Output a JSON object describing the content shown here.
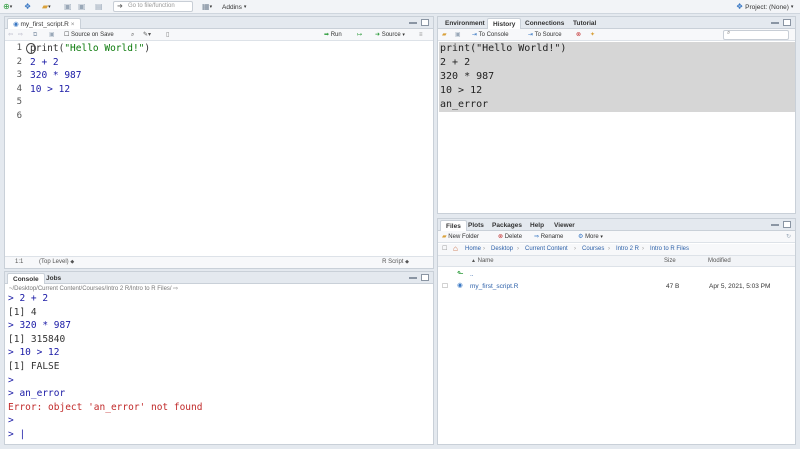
{
  "topbar": {
    "goto_placeholder": "Go to file/function",
    "addins_label": "Addins",
    "project_label": "Project: (None)"
  },
  "editor": {
    "tab_label": "my_first_script.R",
    "source_on_save": "Source on Save",
    "run_label": "Run",
    "source_label": "Source",
    "line_numbers": [
      "1",
      "2",
      "3",
      "4",
      "5",
      "6"
    ],
    "lines": [
      {
        "prefix": "print(",
        "string": "\"Hello World!\"",
        "suffix": ")"
      },
      {
        "code": "2 + 2"
      },
      {
        "code": "320 * 987"
      },
      {
        "code": "10 > 12"
      },
      {
        "code": ""
      },
      {
        "code": ""
      }
    ],
    "cursor_pos": "1:1",
    "scope": "(Top Level)",
    "filetype": "R Script"
  },
  "env_pane": {
    "tabs": [
      "Environment",
      "History",
      "Connections",
      "Tutorial"
    ],
    "active_tab": "History",
    "to_console": "To Console",
    "to_source": "To Source",
    "history": [
      "print(\"Hello World!\")",
      "2 + 2",
      "320 * 987",
      "10 > 12",
      "an_error"
    ]
  },
  "files_pane": {
    "tabs": [
      "Files",
      "Plots",
      "Packages",
      "Help",
      "Viewer"
    ],
    "new_folder": "New Folder",
    "delete": "Delete",
    "rename": "Rename",
    "more": "More",
    "breadcrumbs": [
      "Home",
      "Desktop",
      "Current Content",
      "Courses",
      "Intro 2 R",
      "Intro to R Files"
    ],
    "columns": {
      "name": "Name",
      "size": "Size",
      "modified": "Modified"
    },
    "up_label": "..",
    "files": [
      {
        "name": "my_first_script.R",
        "size": "47 B",
        "modified": "Apr 5, 2021, 5:03 PM"
      }
    ]
  },
  "console": {
    "tabs": [
      "Console",
      "Jobs"
    ],
    "path": "~/Desktop/Current Content/Courses/Intro 2 R/Intro to R Files/",
    "lines": [
      {
        "type": "in",
        "text": "> 2 + 2"
      },
      {
        "type": "out",
        "text": "[1] 4"
      },
      {
        "type": "in",
        "text": "> 320 * 987"
      },
      {
        "type": "out",
        "text": "[1] 315840"
      },
      {
        "type": "in",
        "text": "> 10 > 12"
      },
      {
        "type": "out",
        "text": "[1] FALSE"
      },
      {
        "type": "in",
        "text": ">"
      },
      {
        "type": "in",
        "text": "> an_error"
      },
      {
        "type": "err",
        "text": "Error: object 'an_error' not found"
      },
      {
        "type": "in",
        "text": ">"
      },
      {
        "type": "in",
        "text": "> |"
      }
    ]
  },
  "colors": {
    "code_blue": "#1a1aa6",
    "string_green": "#0b7a0b",
    "error_red": "#c12a2a",
    "history_selection": "#d6d6d6"
  }
}
